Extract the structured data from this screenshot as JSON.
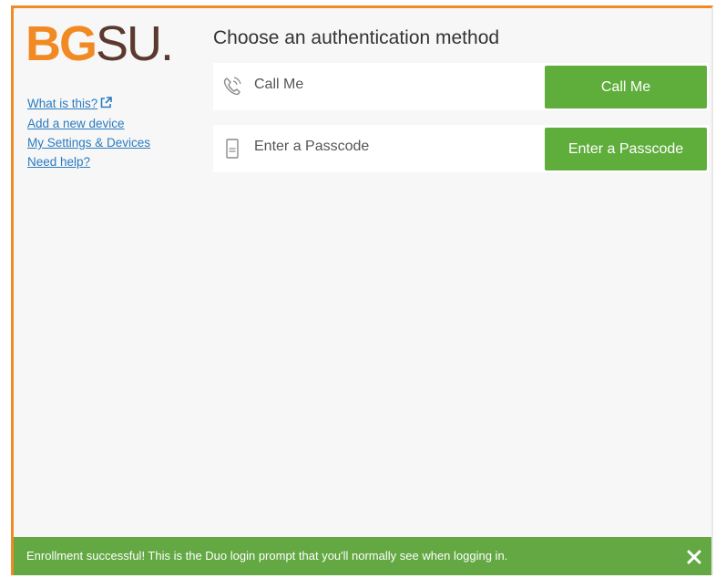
{
  "brand": {
    "logo_bg": "BG",
    "logo_su": "SU",
    "logo_dot": ".",
    "accent": "#f28a24"
  },
  "sidebar": {
    "links": [
      {
        "label": "What is this?",
        "icon": "external-link-icon"
      },
      {
        "label": "Add a new device"
      },
      {
        "label": "My Settings & Devices"
      },
      {
        "label": "Need help?"
      }
    ]
  },
  "main": {
    "title": "Choose an authentication method",
    "methods": [
      {
        "icon": "phone-call-icon",
        "label": "Call Me",
        "button": "Call Me"
      },
      {
        "icon": "passcode-device-icon",
        "label": "Enter a Passcode",
        "button": "Enter a Passcode"
      }
    ]
  },
  "banner": {
    "message": "Enrollment successful! This is the Duo login prompt that you'll normally see when logging in.",
    "close_icon": "close-icon",
    "color": "#63a843"
  },
  "colors": {
    "button": "#5fae3c",
    "link": "#2a7bbf",
    "frame": "#f08a24"
  }
}
